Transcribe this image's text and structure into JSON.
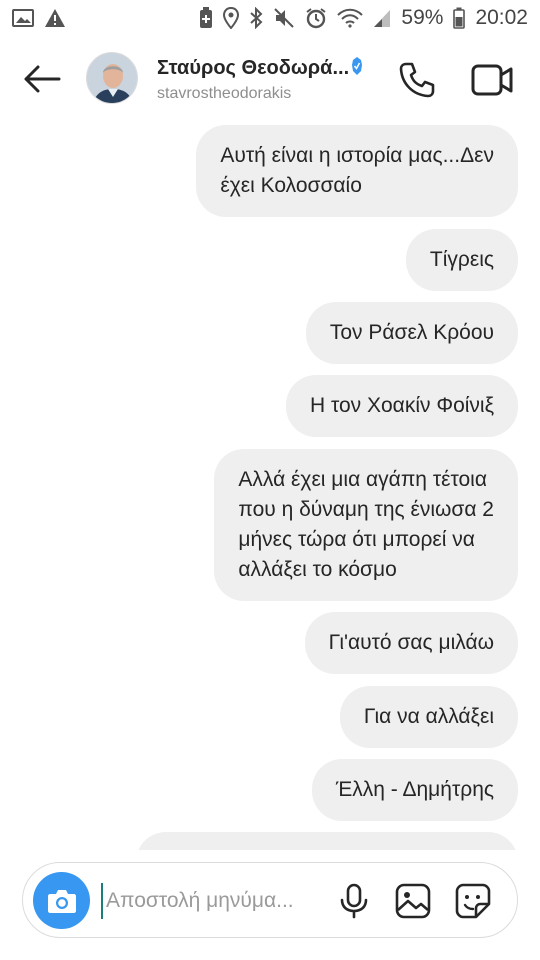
{
  "status_bar": {
    "battery_percent": "59%",
    "time": "20:02",
    "left_icons": [
      "image-icon",
      "warning-icon"
    ],
    "right_icons": [
      "battery-saver-icon",
      "location-icon",
      "bluetooth-icon",
      "mute-icon",
      "alarm-icon",
      "wifi-icon",
      "signal-icon",
      "battery-icon"
    ]
  },
  "header": {
    "name": "Σταύρος Θεοδωρά...",
    "username": "stavrostheodorakis",
    "verified_color": "#3897f0",
    "icons": [
      "back-arrow-icon",
      "phone-icon",
      "video-camera-icon"
    ]
  },
  "messages": [
    {
      "text": "Αυτή είναι η ιστορία μας...Δεν\nέχει Κολοσσαίο"
    },
    {
      "text": "Τίγρεις"
    },
    {
      "text": "Τον Ράσελ Κρόου"
    },
    {
      "text": "Η τον Χοακίν Φοίνιξ"
    },
    {
      "text": "Αλλά έχει μια αγάπη τέτοια\nπου η δύναμη της ένιωσα 2\nμήνες τώρα ότι μπορεί να\nαλλάξει το κόσμο"
    },
    {
      "text": "Γι'αυτό σας μιλάω"
    },
    {
      "text": "Για να αλλάξει"
    },
    {
      "text": "Έλλη - Δημήτρης"
    }
  ],
  "composer": {
    "placeholder": "Αποστολή μηνύμα...",
    "value": "",
    "accent": "#3897f0",
    "icons": [
      "camera-icon",
      "microphone-icon",
      "gallery-icon",
      "sticker-icon"
    ]
  },
  "colors": {
    "bubble_bg": "#efefef",
    "text": "#262626",
    "secondary_text": "#8e8e8e"
  }
}
